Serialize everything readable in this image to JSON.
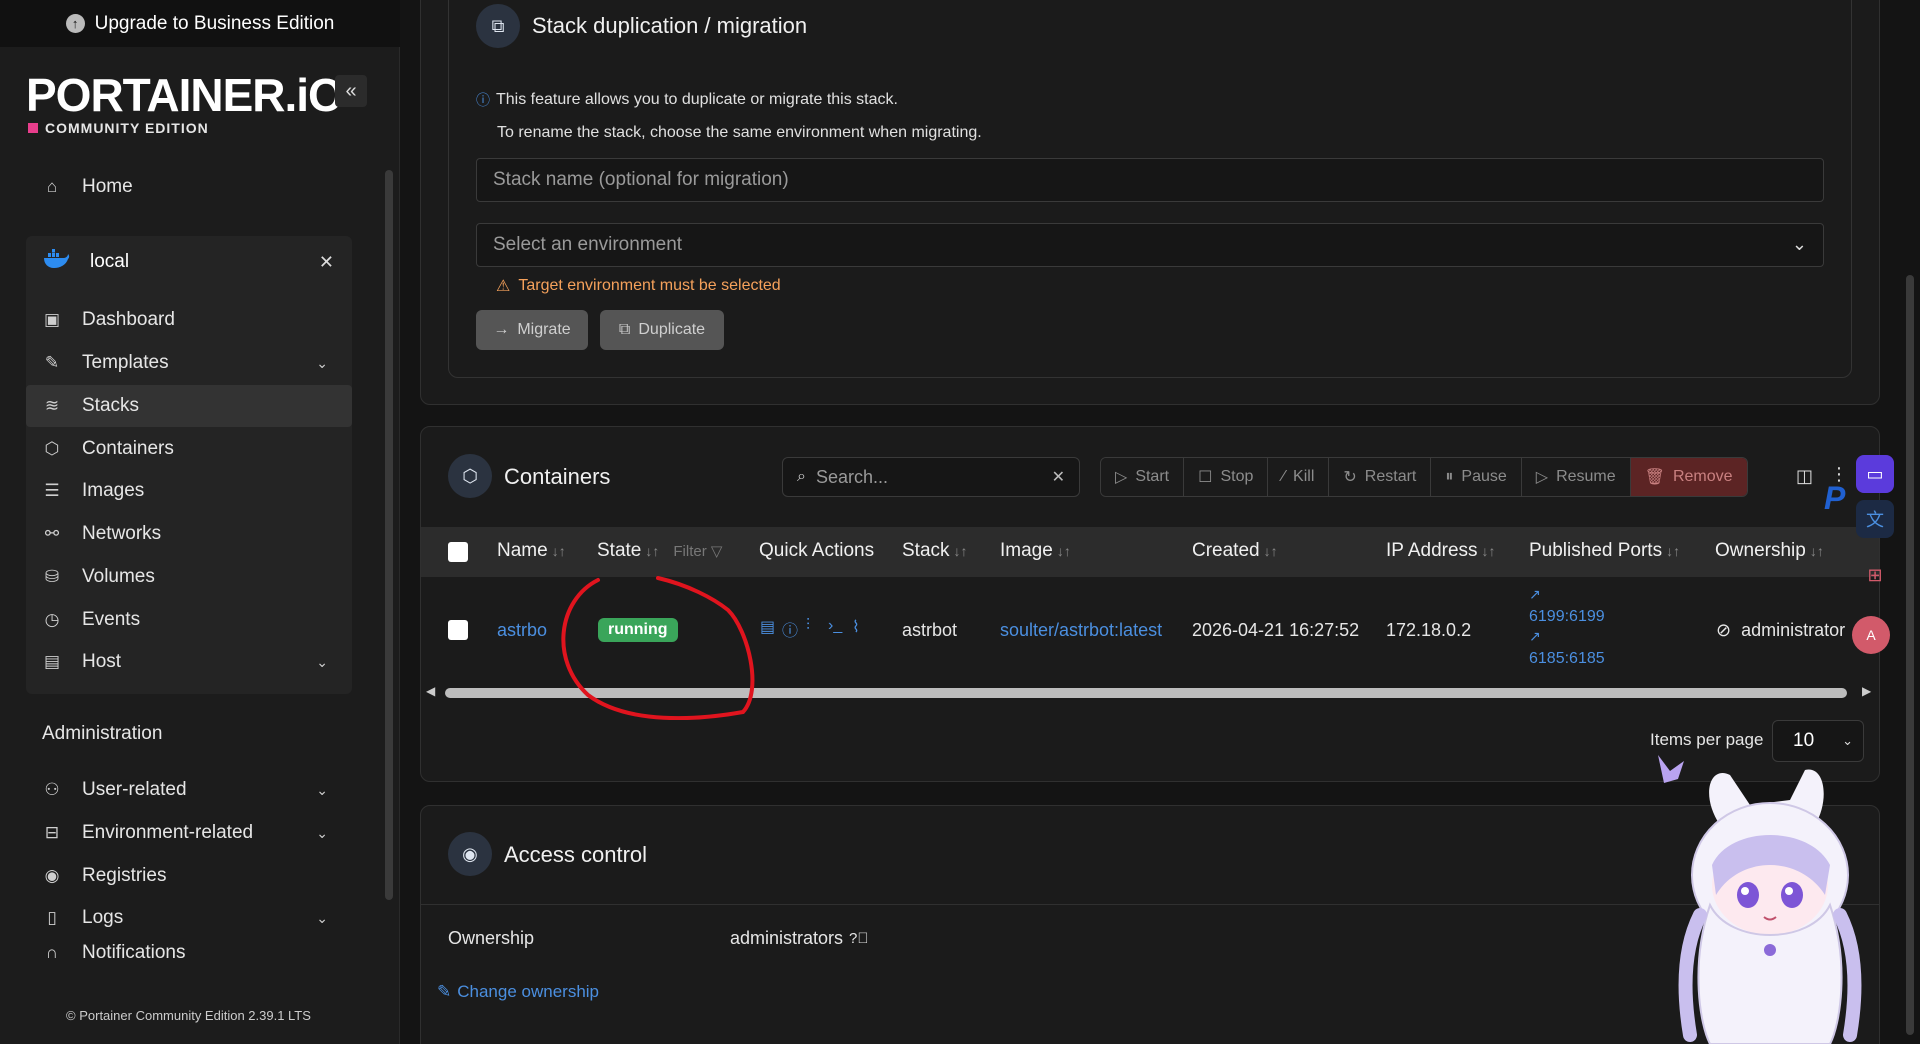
{
  "sidebar": {
    "upgrade_label": "Upgrade to Business Edition",
    "logo": "PORTAINER.iO",
    "edition": "COMMUNITY EDITION",
    "home": "Home",
    "environment": "local",
    "env_items": [
      {
        "label": "Dashboard",
        "icon": "dashboard-icon"
      },
      {
        "label": "Templates",
        "icon": "edit-icon",
        "expandable": true
      },
      {
        "label": "Stacks",
        "icon": "layers-icon",
        "active": true
      },
      {
        "label": "Containers",
        "icon": "box-icon"
      },
      {
        "label": "Images",
        "icon": "list-icon"
      },
      {
        "label": "Networks",
        "icon": "network-icon"
      },
      {
        "label": "Volumes",
        "icon": "database-icon"
      },
      {
        "label": "Events",
        "icon": "clock-icon"
      },
      {
        "label": "Host",
        "icon": "host-icon",
        "expandable": true
      }
    ],
    "administration_title": "Administration",
    "admin_items": [
      {
        "label": "User-related",
        "icon": "users-icon",
        "expandable": true
      },
      {
        "label": "Environment-related",
        "icon": "environment-icon",
        "expandable": true
      },
      {
        "label": "Registries",
        "icon": "radio-icon"
      },
      {
        "label": "Logs",
        "icon": "file-icon",
        "expandable": true
      },
      {
        "label": "Notifications",
        "icon": "bell-icon"
      }
    ],
    "footer": "Portainer Community Edition 2.39.1 LTS"
  },
  "duplication": {
    "title": "Stack duplication / migration",
    "info_line1": "This feature allows you to duplicate or migrate this stack.",
    "info_line2": "To rename the stack, choose the same environment when migrating.",
    "stack_name_placeholder": "Stack name (optional for migration)",
    "env_select_placeholder": "Select an environment",
    "warning": "Target environment must be selected",
    "migrate_label": "Migrate",
    "duplicate_label": "Duplicate"
  },
  "containers": {
    "title": "Containers",
    "search_placeholder": "Search...",
    "actions": [
      "Start",
      "Stop",
      "Kill",
      "Restart",
      "Pause",
      "Resume",
      "Remove"
    ],
    "columns": {
      "name": "Name",
      "state": "State",
      "filter": "Filter",
      "quick_actions": "Quick Actions",
      "stack": "Stack",
      "image": "Image",
      "created": "Created",
      "ip": "IP Address",
      "ports": "Published Ports",
      "ownership": "Ownership"
    },
    "rows": [
      {
        "name": "astrbo",
        "state": "running",
        "stack": "astrbot",
        "image": "soulter/astrbot:latest",
        "created": "2026-04-21 16:27:52",
        "ip": "172.18.0.2",
        "port1": "6199:6199",
        "port2": "6185:6185",
        "ownership": "administrator"
      }
    ],
    "items_per_page_label": "Items per page",
    "items_per_page_value": "10"
  },
  "access_control": {
    "title": "Access control",
    "ownership_label": "Ownership",
    "ownership_value": "administrators",
    "change_label": "Change ownership"
  },
  "colors": {
    "accent_link": "#4b8fe0",
    "status_running": "#3aa55a",
    "warning": "#f5a15b",
    "remove": "#5c2424",
    "annotation": "#e0141e"
  }
}
